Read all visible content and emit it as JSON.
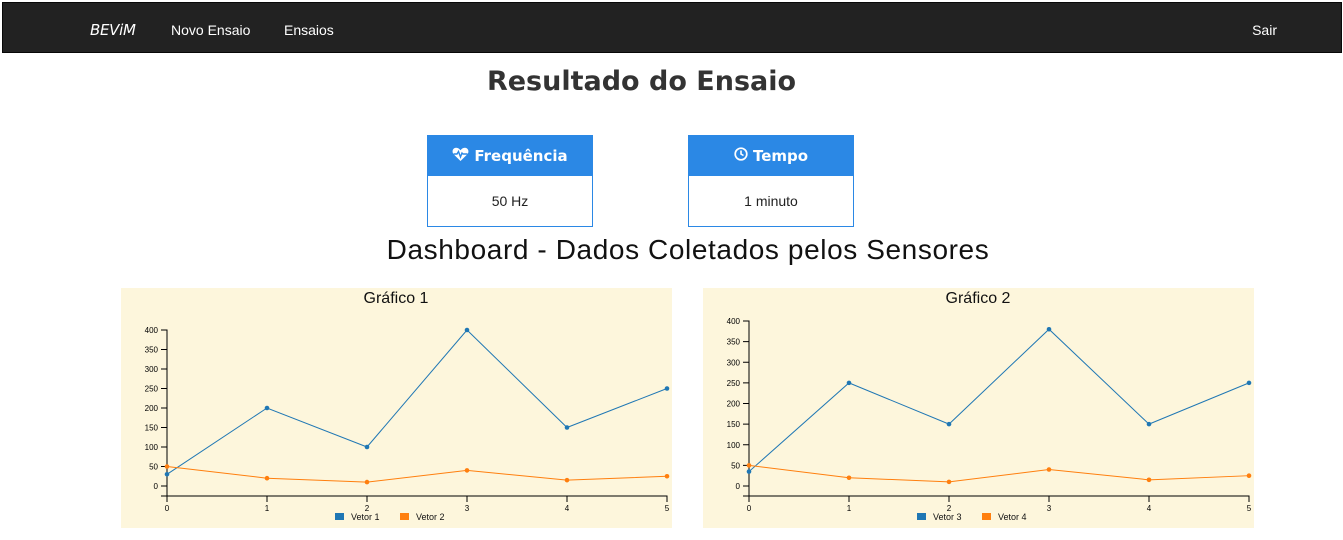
{
  "navbar": {
    "brand": "BEViM",
    "links": [
      "Novo Ensaio",
      "Ensaios"
    ],
    "logout": "Sair"
  },
  "page_title": "Resultado do Ensaio",
  "cards": {
    "frequency": {
      "title": "Frequência",
      "value": "50 Hz",
      "icon": "heart-pulse-icon"
    },
    "time": {
      "title": "Tempo",
      "value": "1 minuto",
      "icon": "clock-icon"
    }
  },
  "dashboard_title": "Dashboard - Dados Coletados pelos Sensores",
  "colors": {
    "navbar": "#222222",
    "card_accent": "#2b88e5",
    "series_blue": "#1f77b4",
    "series_orange": "#ff7f0e",
    "chart_bg": "#fdf6dc"
  },
  "chart_data": [
    {
      "type": "line",
      "title": "Gráfico 1",
      "x": [
        0,
        1,
        2,
        3,
        4,
        5
      ],
      "xticks": [
        "0",
        "1",
        "2",
        "3",
        "4",
        "5"
      ],
      "yticks": [
        "0",
        "50",
        "100",
        "150",
        "200",
        "250",
        "300",
        "350",
        "400"
      ],
      "ylim": [
        0,
        400
      ],
      "series": [
        {
          "name": "Vetor 1",
          "color": "#1f77b4",
          "values": [
            30,
            200,
            100,
            400,
            150,
            250
          ]
        },
        {
          "name": "Vetor 2",
          "color": "#ff7f0e",
          "values": [
            50,
            20,
            10,
            40,
            15,
            25
          ]
        }
      ],
      "legend": "bottom"
    },
    {
      "type": "line",
      "title": "Gráfico 2",
      "x": [
        0,
        1,
        2,
        3,
        4,
        5
      ],
      "xticks": [
        "0",
        "1",
        "2",
        "3",
        "4",
        "5"
      ],
      "yticks": [
        "0",
        "50",
        "100",
        "150",
        "200",
        "250",
        "300",
        "350",
        "400"
      ],
      "ylim": [
        0,
        400
      ],
      "series": [
        {
          "name": "Vetor 3",
          "color": "#1f77b4",
          "values": [
            35,
            250,
            150,
            380,
            150,
            250
          ]
        },
        {
          "name": "Vetor 4",
          "color": "#ff7f0e",
          "values": [
            50,
            20,
            10,
            40,
            15,
            25
          ]
        }
      ],
      "legend": "bottom"
    }
  ]
}
